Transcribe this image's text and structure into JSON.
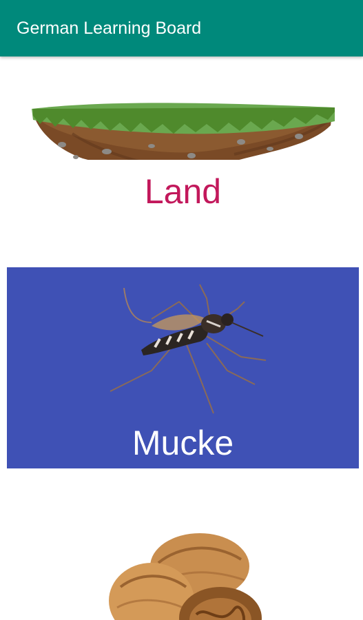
{
  "app_bar": {
    "title": "German Learning Board",
    "color": "#00897b"
  },
  "cards": [
    {
      "word": "Land",
      "image": "floating-island",
      "word_color": "#c2185b",
      "background": "#ffffff"
    },
    {
      "word": "Mucke",
      "image": "mosquito",
      "word_color": "#ffffff",
      "background": "#3f51b5"
    },
    {
      "word": "",
      "image": "walnuts",
      "background": "#ffffff"
    }
  ]
}
